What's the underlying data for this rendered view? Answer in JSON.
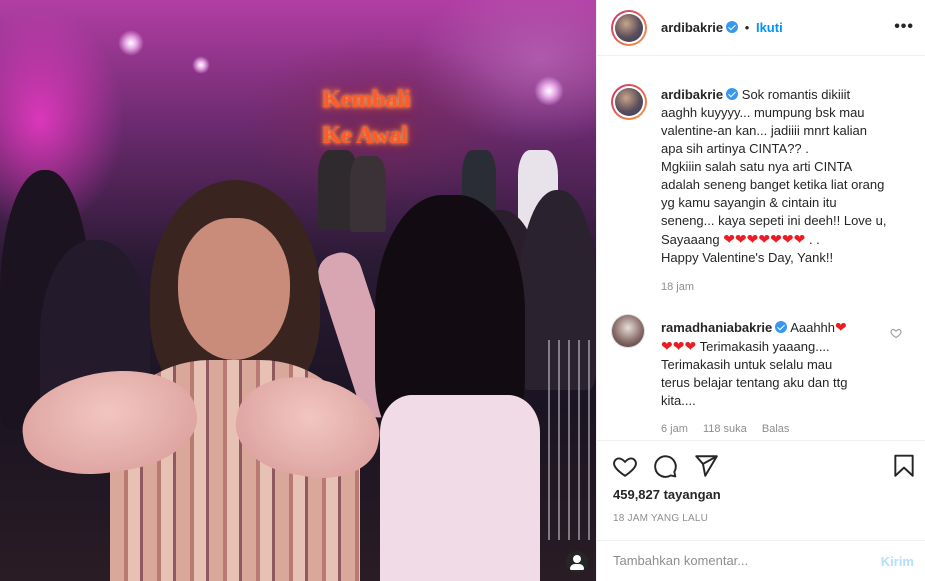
{
  "media": {
    "stage_sign_line1": "Kembali",
    "stage_sign_line2": "Ke Awal",
    "user_tag_icon": "user-icon"
  },
  "header": {
    "username": "ardibakrie",
    "separator": "•",
    "follow_label": "Ikuti",
    "more_icon": "ellipsis-icon",
    "more_glyph": "•••"
  },
  "caption": {
    "username": "ardibakrie",
    "lines": [
      "Sok romantis dikiiit",
      "aaghh kuyyyy... mumpung bsk mau",
      "valentine-an kan... jadiiii mnrt kalian",
      "apa sih artinya CINTA?? .",
      "Mgkiiin salah satu nya arti CINTA",
      "adalah seneng banget ketika liat orang",
      "yg kamu sayangin & cintain itu",
      "seneng... kaya sepeti ini deeh!! Love u,",
      "Sayaaang"
    ],
    "hearts": "❤❤❤❤❤❤❤",
    "after_hearts": ". .",
    "last_line": "Happy Valentine's Day, Yank!!",
    "time": "18 jam"
  },
  "reply": {
    "username": "ramadhaniabakrie",
    "first_word": "Aaahhh",
    "first_hearts": "❤",
    "second_hearts": "❤❤❤",
    "second_text": "Terimakasih yaaang....",
    "lines": [
      "Terimakasih untuk selalu mau",
      "terus belajar tentang aku dan ttg",
      "kita...."
    ],
    "time": "6 jam",
    "likes": "118 suka",
    "reply_label": "Balas"
  },
  "actions": {
    "icons": [
      "heart-icon",
      "comment-icon",
      "share-icon",
      "bookmark-icon"
    ],
    "views": "459,827 tayangan",
    "time_ago": "18 JAM YANG LALU"
  },
  "comment_box": {
    "placeholder": "Tambahkan komentar...",
    "post_label": "Kirim"
  },
  "colors": {
    "accent": "#0095f6",
    "verified": "#3897f0",
    "heart": "#ed1c24",
    "muted": "#8e8e8e"
  }
}
